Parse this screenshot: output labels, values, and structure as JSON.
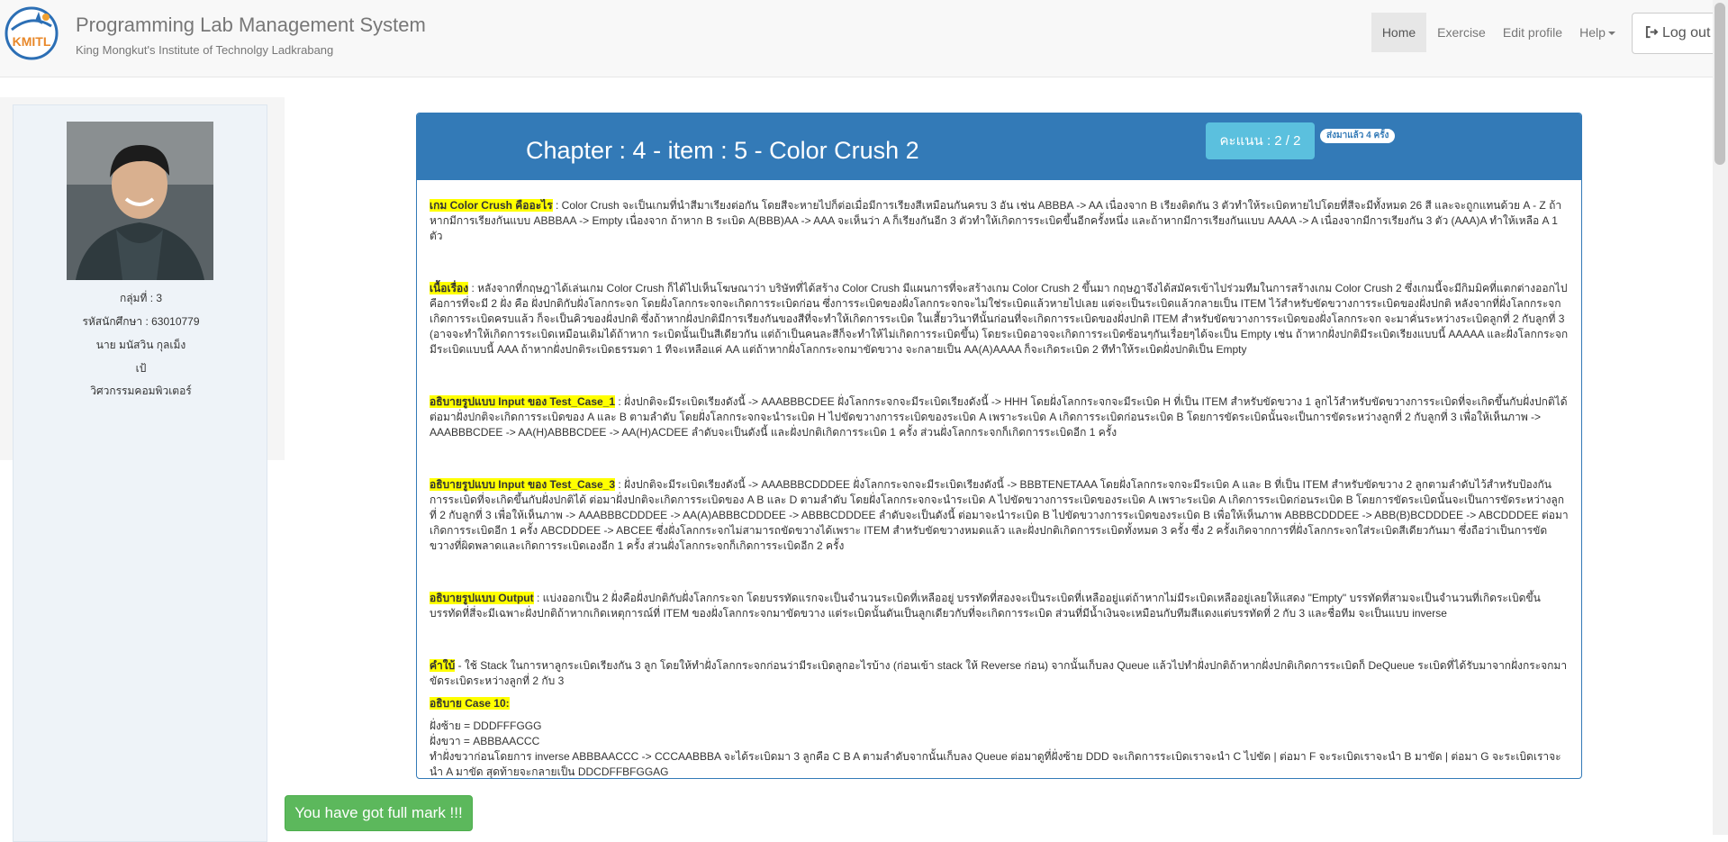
{
  "header": {
    "title": "Programming Lab Management System",
    "subtitle": "King Mongkut's Institute of Technolgy Ladkrabang",
    "logo_text": "KMITL",
    "nav": {
      "home": "Home",
      "exercise": "Exercise",
      "edit_profile": "Edit profile",
      "help": "Help",
      "logout": "Log out"
    }
  },
  "profile": {
    "group": "กลุ่มที่ : 3",
    "student_id": "รหัสนักศึกษา : 63010779",
    "name": "นาย มนัสวิน กุลเม็ง",
    "nickname": "เป้",
    "department": "วิศวกรรมคอมพิวเตอร์"
  },
  "exercise": {
    "title": "Chapter : 4 - item : 5 - Color Crush 2",
    "score": "คะแนน : 2 / 2",
    "submitted": "ส่งมาแล้ว 4 ครั้ง",
    "sections": [
      {
        "heading": "เกม Color Crush คืออะไร",
        "text": " : Color Crush จะเป็นเกมที่นำสีมาเรียงต่อกัน โดยสีจะหายไปก็ต่อเมื่อมีการเรียงสีเหมือนกันครบ 3 อัน เช่น  ABBBA  -> AA  เนื่องจาก B เรียงติดกัน 3 ตัวทำให้ระเบิดหายไปโดยที่สีจะมีทั้งหมด 26 สี และจะถูกแทนด้วย A - Z  ถ้าหากมีการเรียงกันแบบ  ABBBAA -> Empty  เนื่องจาก  ถ้าหาก B ระเบิด  A(BBB)AA -> AAA จะเห็นว่า A ก็เรียงกันอีก 3 ตัวทำให้เกิดการระเบิดขึ้นอีกครั้งหนึ่ง  และถ้าหากมีการเรียงกันแบบ AAAA -> A เนื่องจากมีการเรียงกัน 3 ตัว  (AAA)A ทำให้เหลือ A 1 ตัว"
      },
      {
        "heading": "เนื้อเรื่อง",
        "text": " :  หลังจากที่กฤษฎาได้เล่นเกม Color Crush ก็ได้ไปเห็นโฆษณาว่า บริษัทที่ได้สร้าง Color Crush มีแผนการที่จะสร้างเกม Color Crush 2 ขึ้นมา กฤษฎาจึงได้สมัครเข้าไปร่วมทีมในการสร้างเกม Color Crush 2 ซึ่งเกมนี้จะมีกิมมิคที่แตกต่างออกไป คือการที่จะมี 2 ฝั่ง คือ ฝั่งปกติกับฝั่งโลกกระจก โดยฝั่งโลกกระจกจะเกิดการระเบิดก่อน ซึ่งการระเบิดของฝั่งโลกกระจกจะไม่ใช่ระเบิดแล้วหายไปเลย แต่จะเป็นระเบิดแล้วกลายเป็น ITEM ไว้สำหรับขัดขวางการระเบิดของฝั่งปกติ  หลังจากที่ฝั่งโลกกระจกเกิดการระเบิดครบแล้ว ก็จะเป็นคิวของฝั่งปกติ  ซึ่งถ้าหากฝั่งปกติมีการเรียงกันของสีที่จะทำให้เกิดการระเบิด ในเสี้ยววินาทีนั้นก่อนที่จะเกิดการระเบิดของฝั่งปกติ  ITEM สำหรับขัดขวางการระเบิดของฝั่งโลกกระจก จะมาคั่นระหว่างระเบิดลูกที่ 2 กับลูกที่ 3 (อาจจะทำให้เกิดการระเบิดเหมือนเดิมได้ถ้าหาก ระเบิดนั้นเป็นสีเดียวกัน  แต่ถ้าเป็นคนละสีก็จะทำให้ไม่เกิดการระเบิดขึ้น)  โดยระเบิดอาจจะเกิดการระเบิดซ้อนๆกันเรื่อยๆได้จะเป็น Empty  เช่น ถ้าหากฝั่งปกติมีระเบิดเรียงแบบนี้ AAAAA และฝั่งโลกกระจกมีระเบิดแบบนี้ AAA ถ้าหากฝั่งปกติระเบิดธรรมดา 1 ทีจะเหลือแค่ AA แต่ถ้าหากฝั่งโลกกระจกมาขัดขวาง จะกลายเป็น AA(A)AAAA ก็จะเกิดระเบิด 2 ทีทำให้ระเบิดฝั่งปกติเป็น Empty"
      },
      {
        "heading": "อธิบายรูปแบบ Input ของ Test_Case_1",
        "text": " : ฝั่งปกติจะมีระเบิดเรียงดังนี้ -> AAABBBCDEE  ฝั่งโลกกระจกจะมีระเบิดเรียงดังนี้ -> HHH โดยฝั่งโลกกระจกจะมีระเบิด H ที่เป็น ITEM สำหรับขัดขวาง 1 ลูกไว้สำหรับขัดขวางการระเบิดที่จะเกิดขึ้นกับฝั่งปกติได้  ต่อมาฝั่งปกติจะเกิดการระเบิดของ A และ B ตามลำดับ  โดยฝั่งโลกกระจกจะนำระเบิด H ไปขัดขวางการระเบิดของระเบิด A เพราะระเบิด A เกิดการระเบิดก่อนระเบิด B  โดยการขัดระเบิดนั้นจะเป็นการขัดระหว่างลูกที่ 2 กับลูกที่ 3 เพื่อให้เห็นภาพ -> AAABBBCDEE -> AA(H)ABBBCDEE  -> AA(H)ACDEE ลำดับจะเป็นดังนี้  และฝั่งปกติเกิดการระเบิด 1 ครั้ง ส่วนฝั่งโลกกระจกก็เกิดการระเบิดอีก 1 ครั้ง"
      },
      {
        "heading": "อธิบายรูปแบบ Input ของ Test_Case_3",
        "text": " : ฝั่งปกติจะมีระเบิดเรียงดังนี้ -> AAABBBCDDDEE  ฝั่งโลกกระจกจะมีระเบิดเรียงดังนี้ -> BBBTENETAAA โดยฝั่งโลกกระจกจะมีระเบิด A และ B ที่เป็น ITEM สำหรับขัดขวาง 2 ลูกตามลำดับไว้สำหรับป้องกันการระเบิดที่จะเกิดขึ้นกับฝั่งปกติได้  ต่อมาฝั่งปกติจะเกิดการระเบิดของ A B และ D ตามลำดับ  โดยฝั่งโลกกระจกจะนำระเบิด A  ไปขัดขวางการระเบิดของระเบิด A เพราะระเบิด A เกิดการระเบิดก่อนระเบิด B  โดยการขัดระเบิดนั้นจะเป็นการขัดระหว่างลูกที่ 2 กับลูกที่ 3  เพื่อให้เห็นภาพ -> AAABBBCDDDEE -> AA(A)ABBBCDDDEE -> ABBBCDDDEE ลำดับจะเป็นดังนี้  ต่อมาจะนำระเบิด B ไปขัดขวางการระเบิดของระเบิด B เพื่อให้เห็นภาพ  ABBBCDDDEE -> ABB(B)BCDDDEE -> ABCDDDEE  ต่อมาเกิดการระเบิดอีก 1 ครั้ง ABCDDDEE -> ABCEE ซึ่งฝั่งโลกกระจกไม่สามารถขัดขวางได้เพราะ ITEM สำหรับขัดขวางหมดแล้ว   และฝั่งปกติเกิดการระเบิดทั้งหมด 3 ครั้ง  ซึ่ง 2 ครั้งเกิดจากการที่ฝั่งโลกกระจกใส่ระเบิดสีเดียวกันมา ซึ่งถือว่าเป็นการขัดขวางที่ผิดพลาดและเกิดการระเบิดเองอีก 1 ครั้ง ส่วนฝั่งโลกกระจกก็เกิดการระเบิดอีก 2 ครั้ง"
      },
      {
        "heading": "อธิบายรูปแบบ Output",
        "text": " : แบ่งออกเป็น 2 ฝั่งคือฝั่งปกติกับฝั่งโลกกระจก  โดยบรรทัดแรกจะเป็นจำนวนระเบิดที่เหลืออยู่ บรรทัดที่สองจะเป็นระเบิดที่เหลืออยู่แต่ถ้าหากไม่มีระเบิดเหลืออยู่เลยให้แสดง \"Empty\" บรรทัดที่สามจะเป็นจำนวนที่เกิดระเบิดขึ้น บรรทัดที่สี่จะมีเฉพาะฝั่งปกติถ้าหากเกิดเหตุการณ์ที่ ITEM ของฝั่งโลกกระจกมาขัดขวาง แต่ระเบิดนั้นดันเป็นลูกเดียวกับที่จะเกิดการระเบิด  ส่วนที่มีน้ำเงินจะเหมือนกับทีมสีแดงแต่บรรทัดที่ 2 กับ 3 และชื่อทีม จะเป็นแบบ inverse"
      },
      {
        "heading": "คำใบ้",
        "text": " - ใช้ Stack ในการหาลูกระเบิดเรียงกัน 3 ลูก   โดยให้ทำฝั่งโลกกระจกก่อนว่ามีระเบิดลูกอะไรบ้าง (ก่อนเข้า stack ให้ Reverse ก่อน)  จากนั้นเก็บลง Queue แล้วไปทำฝั่งปกติถ้าหากฝั่งปกติเกิดการระเบิดก็ DeQueue ระเบิดที่ได้รับมาจากฝั่งกระจกมาขัดระเบิดระหว่างลูกที่ 2 กับ 3"
      }
    ],
    "case10": {
      "heading": "อธิบาย Case 10:",
      "lines": [
        "ฝั่งซ้าย = DDDFFFGGG",
        "ฝั่งขวา = ABBBAACCC",
        "ทำฝั่งขวาก่อนโดยการ inverse ABBBAACCC -> CCCAABBBA จะได้ระเบิดมา 3 ลูกคือ C B A ตามลำดับจากนั้นเก็บลง Queue ต่อมาดูที่ฝั่งซ้าย DDD จะเกิดการระเบิดเราจะนำ C ไปขัด | ต่อมา F จะระเบิดเราจะนำ B มาขัด | ต่อมา G จะระเบิดเราจะนำ A มาขัด   สุดท้ายจะกลายเป็น DDCDFFBFGGAG"
      ]
    }
  },
  "fullmark": "You have got full mark !!!",
  "colors": {
    "primary": "#337ab7",
    "info": "#5bc0de",
    "success": "#5cb85c",
    "highlight": "#ffff00"
  }
}
